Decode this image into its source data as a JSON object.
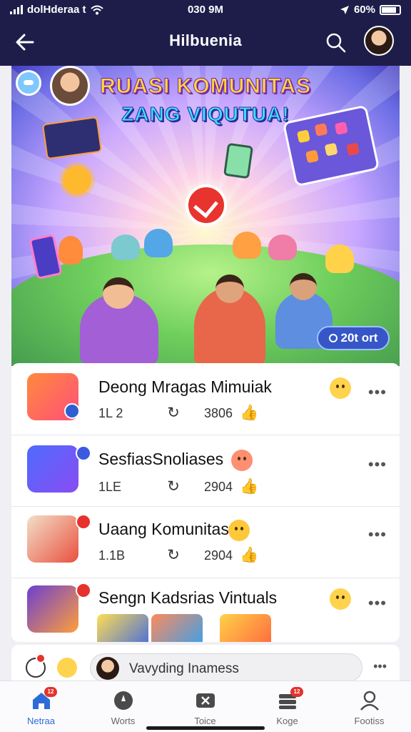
{
  "status_bar": {
    "carrier": "dolHderaa t",
    "time": "030 9M",
    "battery": "60%"
  },
  "header": {
    "title": "Hilbuenia",
    "back_icon": "back-arrow-icon",
    "search_icon": "search-icon"
  },
  "banner": {
    "title_line1": "RUASI KOMUNITAS",
    "title_line2": "ZANG VIQUTUA!",
    "stat": "20t ort",
    "colors": {
      "title1": "#ffd83a",
      "title2": "#3ee0ff",
      "pill": "#3656c8"
    }
  },
  "feed": {
    "items": [
      {
        "title": "Deong Mragas Mimuiak",
        "count": "1L 2",
        "likes": "3806",
        "emoji": "smile-emoji-icon"
      },
      {
        "title": "SesfiasSnoliases",
        "count": "1LE",
        "likes": "2904",
        "emoji": "blush-emoji-icon"
      },
      {
        "title": "Uaang Komunitas",
        "count": "1.1B",
        "likes": "2904",
        "emoji": "grin-emoji-icon"
      },
      {
        "title": "Sengn Kadsrias Vintuals",
        "emoji": "smile-emoji-icon"
      }
    ],
    "more_label": "•••"
  },
  "comment_bar": {
    "placeholder": "Vavyding Inamess",
    "more_label": "•••"
  },
  "tabs": [
    {
      "label": "Netraa",
      "icon": "home-icon",
      "active": true,
      "badge": "12"
    },
    {
      "label": "Worts",
      "icon": "explore-icon",
      "active": false
    },
    {
      "label": "Toice",
      "icon": "video-icon",
      "active": false
    },
    {
      "label": "Koge",
      "icon": "inbox-icon",
      "active": false,
      "badge": "12"
    },
    {
      "label": "Footiss",
      "icon": "profile-icon",
      "active": false
    }
  ]
}
